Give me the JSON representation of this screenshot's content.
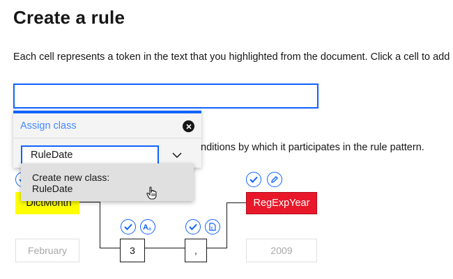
{
  "page": {
    "title": "Create a rule",
    "description": "Each cell represents a token in the text that you highlighted from the document. Click a cell to add",
    "description_tail": "nditions by which it participates in the rule pattern."
  },
  "text_input": {
    "value": ""
  },
  "assign_class": {
    "title": "Assign class",
    "input_value": "RuleDate",
    "close_icon": "close-icon",
    "dropdown_icon": "chevron-down-icon",
    "menu_item_line1": "Create new class:",
    "menu_item_line2": "RuleDate"
  },
  "tokens": {
    "dictmonth": {
      "label": "DictMonth",
      "value": "February",
      "color": "#ffff00"
    },
    "number": {
      "value": "3"
    },
    "comma": {
      "value": ","
    },
    "regexpyear": {
      "label": "RegExpYear",
      "value": "2009",
      "color": "#e8182a"
    }
  },
  "colors": {
    "accent": "#0f62fe",
    "link": "#4589ff"
  }
}
